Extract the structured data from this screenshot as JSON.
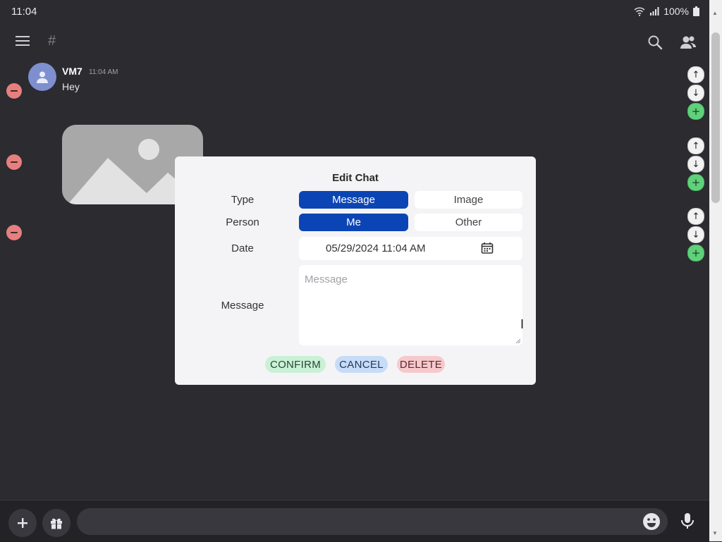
{
  "status": {
    "time": "11:04",
    "battery": "100%"
  },
  "appbar": {
    "menu_icon": "menu-icon",
    "channel_icon": "#",
    "search_icon": "search-icon",
    "members_icon": "people-icon"
  },
  "messages": [
    {
      "author": "VM7",
      "time": "11:04 AM",
      "text": "Hey"
    }
  ],
  "dialog": {
    "title": "Edit Chat",
    "type_label": "Type",
    "type_options": [
      "Message",
      "Image"
    ],
    "type_selected": "Message",
    "person_label": "Person",
    "person_options": [
      "Me",
      "Other"
    ],
    "person_selected": "Me",
    "date_label": "Date",
    "date_value": "05/29/2024 11:04 AM",
    "message_label": "Message",
    "message_placeholder": "Message",
    "message_value": "",
    "confirm": "CONFIRM",
    "cancel": "CANCEL",
    "delete": "DELETE"
  },
  "colors": {
    "background": "#2b2b30",
    "selected": "#0b45b5",
    "confirm_bg": "#c9f1d6",
    "cancel_bg": "#c7dcf7",
    "delete_bg": "#f6c9cc",
    "remove": "#e77f7f",
    "add": "#5fd17a"
  }
}
